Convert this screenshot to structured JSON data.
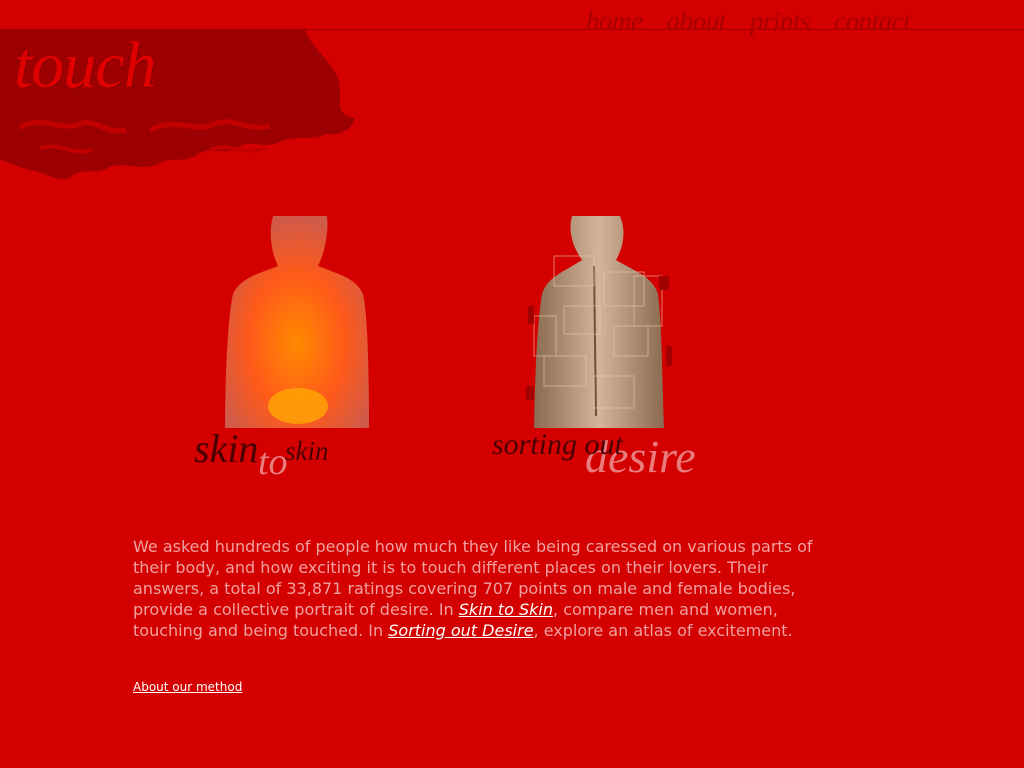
{
  "nav": {
    "home": "home",
    "about": "about",
    "prints": "prints",
    "contact": "contact"
  },
  "logo": {
    "text": "touch"
  },
  "captions": {
    "skin1": "skin",
    "to": "to",
    "skin2": "skin",
    "sorting": "sorting out",
    "desire": "desire"
  },
  "intro": {
    "p1": "We asked hundreds of people how much they like being caressed on various parts of their body, and how exciting it is to touch different places on their lovers. Their answers, a total of 33,871 ratings covering 707 points on male and female bodies, provide a collective portrait of desire. In ",
    "link1": "Skin to Skin",
    "p2": ", compare men and women, touching and being touched. In ",
    "link2": "Sorting out Desire",
    "p3": ", explore an atlas of excitement."
  },
  "method_link": "About our method"
}
